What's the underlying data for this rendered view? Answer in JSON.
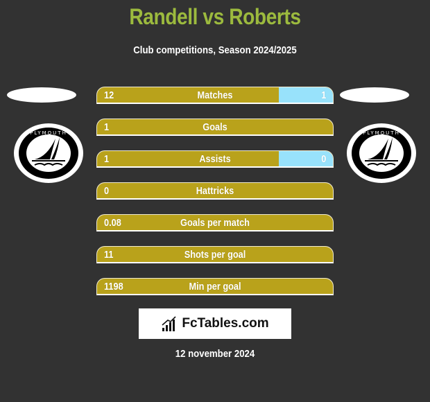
{
  "header": {
    "title": "Randell vs Roberts",
    "subtitle": "Club competitions, Season 2024/2025"
  },
  "players": {
    "left": {
      "name": "Randell",
      "club_logo": "plymouth-argyle-logo",
      "logo_text": "PLYMOUTH"
    },
    "right": {
      "name": "Roberts",
      "club_logo": "plymouth-argyle-logo",
      "logo_text": "PLYMOUTH"
    }
  },
  "colors": {
    "background": "#323232",
    "title": "#9cba3e",
    "left_bar": "#b9a21b",
    "right_bar": "#98e2fb"
  },
  "stats": [
    {
      "label": "Matches",
      "left": "12",
      "right": "1",
      "right_share": 0.23
    },
    {
      "label": "Goals",
      "left": "1",
      "right": "",
      "right_share": 0
    },
    {
      "label": "Assists",
      "left": "1",
      "right": "0",
      "right_share": 0.23
    },
    {
      "label": "Hattricks",
      "left": "0",
      "right": "",
      "right_share": 0
    },
    {
      "label": "Goals per match",
      "left": "0.08",
      "right": "",
      "right_share": 0
    },
    {
      "label": "Shots per goal",
      "left": "11",
      "right": "",
      "right_share": 0
    },
    {
      "label": "Min per goal",
      "left": "1198",
      "right": "",
      "right_share": 0
    }
  ],
  "brand": {
    "text": "FcTables.com",
    "icon": "bar-chart-icon"
  },
  "date": "12 november 2024"
}
